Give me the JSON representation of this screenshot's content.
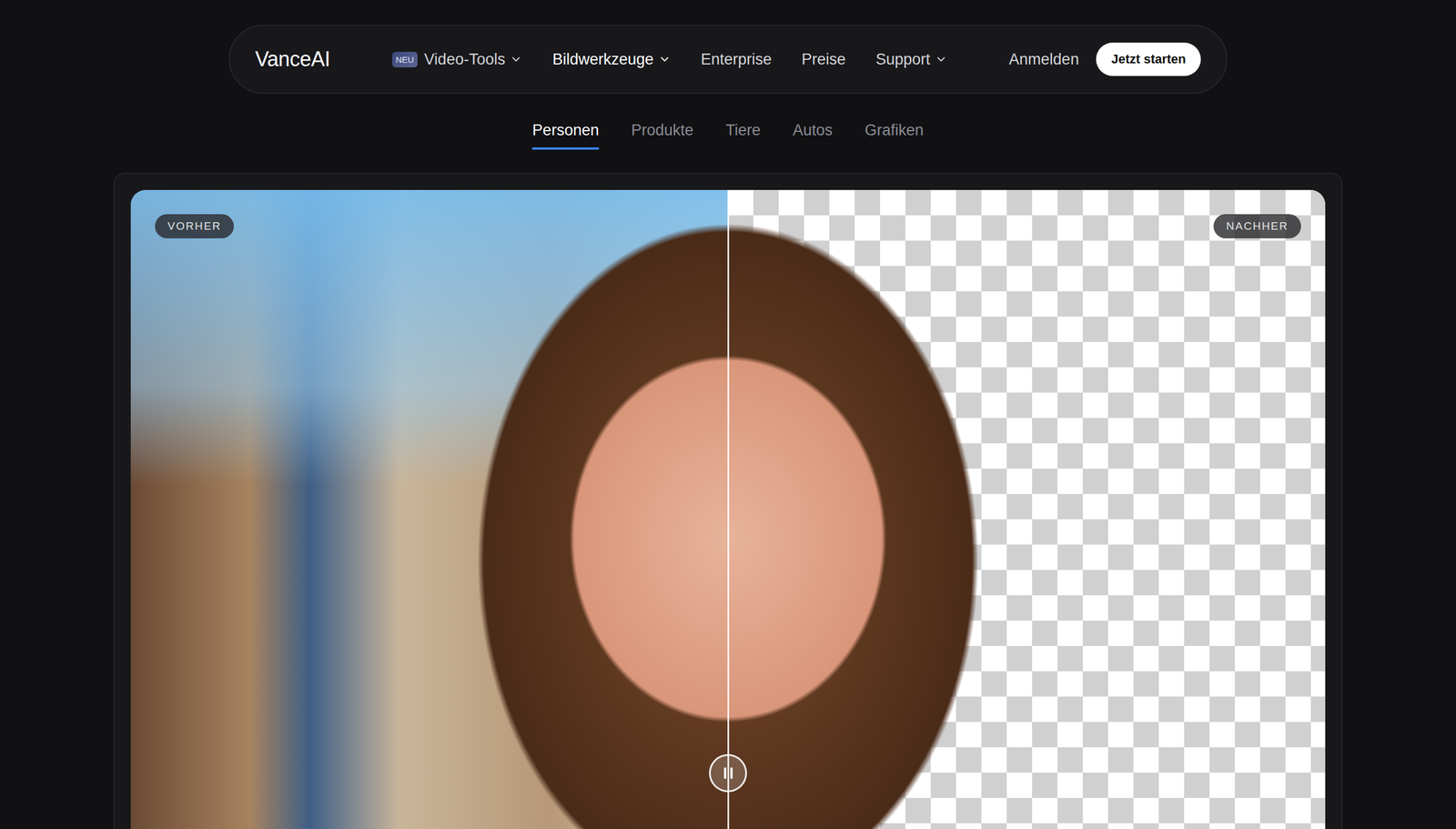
{
  "nav": {
    "logo": "VanceAI",
    "items": [
      {
        "label": "Video-Tools",
        "badge": "NEU",
        "dropdown": true,
        "selected": false
      },
      {
        "label": "Bildwerkzeuge",
        "dropdown": true,
        "selected": true
      },
      {
        "label": "Enterprise",
        "dropdown": false,
        "selected": false
      },
      {
        "label": "Preise",
        "dropdown": false,
        "selected": false
      },
      {
        "label": "Support",
        "dropdown": true,
        "selected": false
      }
    ],
    "login": "Anmelden",
    "cta": "Jetzt starten"
  },
  "tabs": [
    {
      "label": "Personen",
      "selected": true
    },
    {
      "label": "Produkte",
      "selected": false
    },
    {
      "label": "Tiere",
      "selected": false
    },
    {
      "label": "Autos",
      "selected": false
    },
    {
      "label": "Grafiken",
      "selected": false
    }
  ],
  "compare": {
    "before": "VORHER",
    "after": "NACHHER",
    "split": 0.5
  }
}
